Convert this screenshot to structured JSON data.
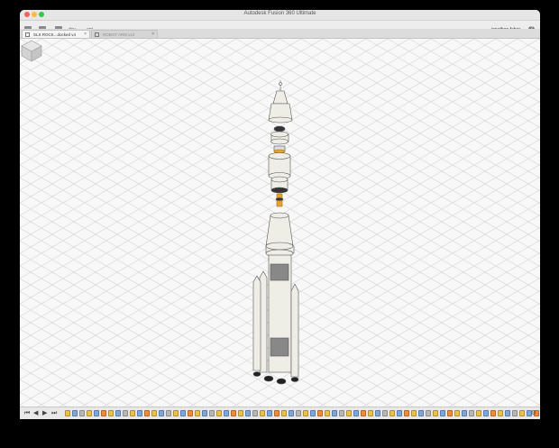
{
  "window": {
    "title": "Autodesk Fusion 360 Ultimate"
  },
  "toolbar": {
    "project": "dev",
    "sub": "ant",
    "user": "jonathan faber",
    "help": "?"
  },
  "tabs": [
    {
      "label": "SLS ROCK...docked v4",
      "close": "×",
      "active": true
    },
    {
      "label": "ROBOT ARM v14",
      "close": "×",
      "active": false
    }
  ],
  "timeline": {
    "feature_colors": [
      "#e9c24a",
      "#7da7d9",
      "#b8b8b8",
      "#e9c24a",
      "#7da7d9",
      "#f08a3a"
    ],
    "feature_count": 76
  },
  "colors": {
    "feature_bg_hint": "#e8e8e8"
  }
}
